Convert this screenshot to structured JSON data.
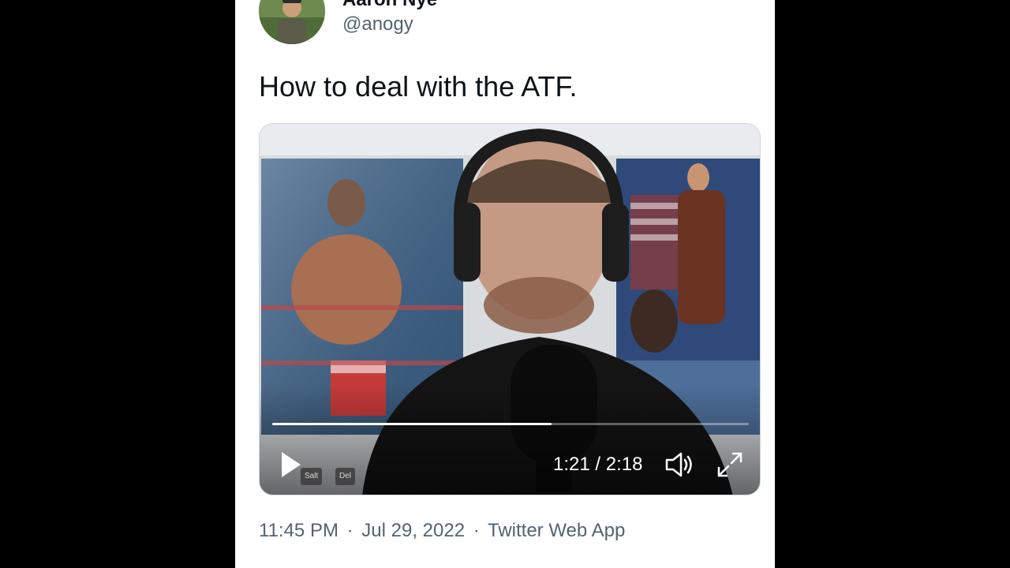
{
  "author": {
    "display_name": "Aaron Nye",
    "handle": "@anogy",
    "avatar_icon": "profile-photo"
  },
  "tweet": {
    "text": "How to deal with the ATF."
  },
  "video": {
    "elapsed": "1:21",
    "separator": "/",
    "duration": "2:18",
    "progress": 0.586,
    "keys": [
      "Salt",
      "Del"
    ],
    "icons": {
      "play": "play-icon",
      "volume": "volume-icon",
      "fullscreen": "fullscreen-icon"
    }
  },
  "meta": {
    "time": "11:45 PM",
    "dot1": "·",
    "date": "Jul 29, 2022",
    "dot2": "·",
    "source": "Twitter Web App"
  },
  "colors": {
    "background": "#000000",
    "card": "#ffffff",
    "text_primary": "#0f1419",
    "text_secondary": "#536471"
  }
}
